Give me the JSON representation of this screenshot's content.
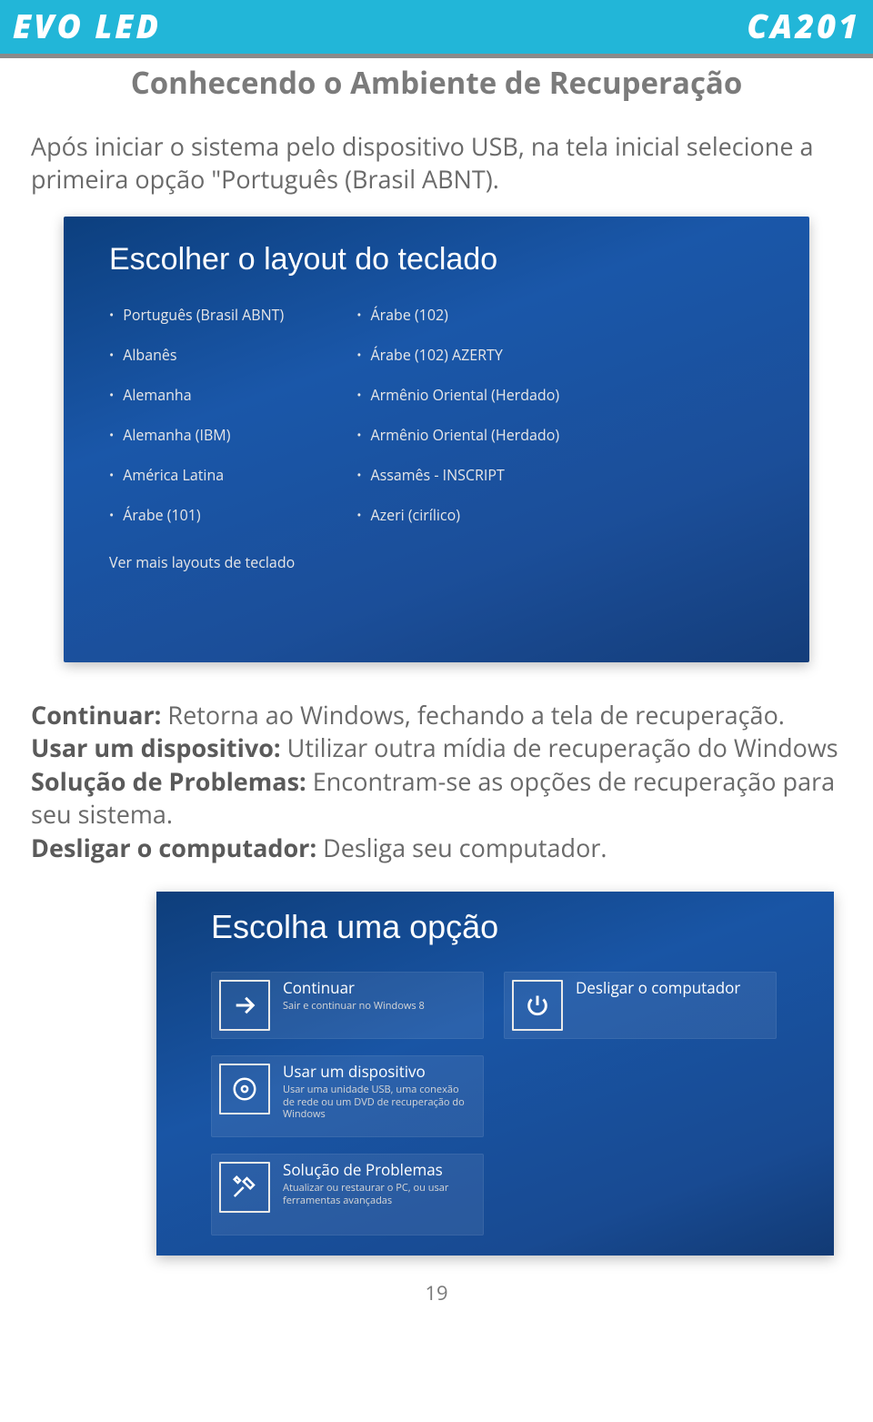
{
  "header": {
    "brand_left": "EVO LED",
    "brand_right": "CA201"
  },
  "section_title": "Conhecendo o Ambiente de Recuperação",
  "intro": "Após iniciar o sistema pelo dispositivo USB, na tela inicial selecione a primeira opção \"Português (Brasil ABNT).",
  "screenshot1": {
    "title": "Escolher o layout do teclado",
    "col1": [
      "Português (Brasil ABNT)",
      "Albanês",
      "Alemanha",
      "Alemanha (IBM)",
      "América Latina",
      "Árabe (101)"
    ],
    "col2": [
      "Árabe (102)",
      "Árabe (102) AZERTY",
      "Armênio Oriental (Herdado)",
      "Armênio Oriental (Herdado)",
      "Assamês - INSCRIPT",
      "Azeri (cirílico)"
    ],
    "more": "Ver mais layouts de teclado"
  },
  "defs": {
    "continuar_label": "Continuar:",
    "continuar_text": " Retorna ao Windows, fechando a tela de recuperação.",
    "usar_label": "Usar um dispositivo:",
    "usar_text": " Utilizar outra mídia de recuperação do Windows",
    "solucao_label": "Solução de Problemas:",
    "solucao_text": " Encontram-se as opções de recuperação para seu sistema.",
    "desligar_label": "Desligar o computador:",
    "desligar_text": " Desliga seu computador."
  },
  "screenshot2": {
    "title": "Escolha uma opção",
    "tiles": {
      "continuar": {
        "title": "Continuar",
        "sub": "Sair e continuar no Windows 8"
      },
      "usar": {
        "title": "Usar um dispositivo",
        "sub": "Usar uma unidade USB, uma conexão de rede ou um DVD de recuperação do Windows"
      },
      "solucao": {
        "title": "Solução de Problemas",
        "sub": "Atualizar ou restaurar o PC, ou usar ferramentas avançadas"
      },
      "desligar": {
        "title": "Desligar o computador",
        "sub": ""
      }
    }
  },
  "page_number": "19"
}
